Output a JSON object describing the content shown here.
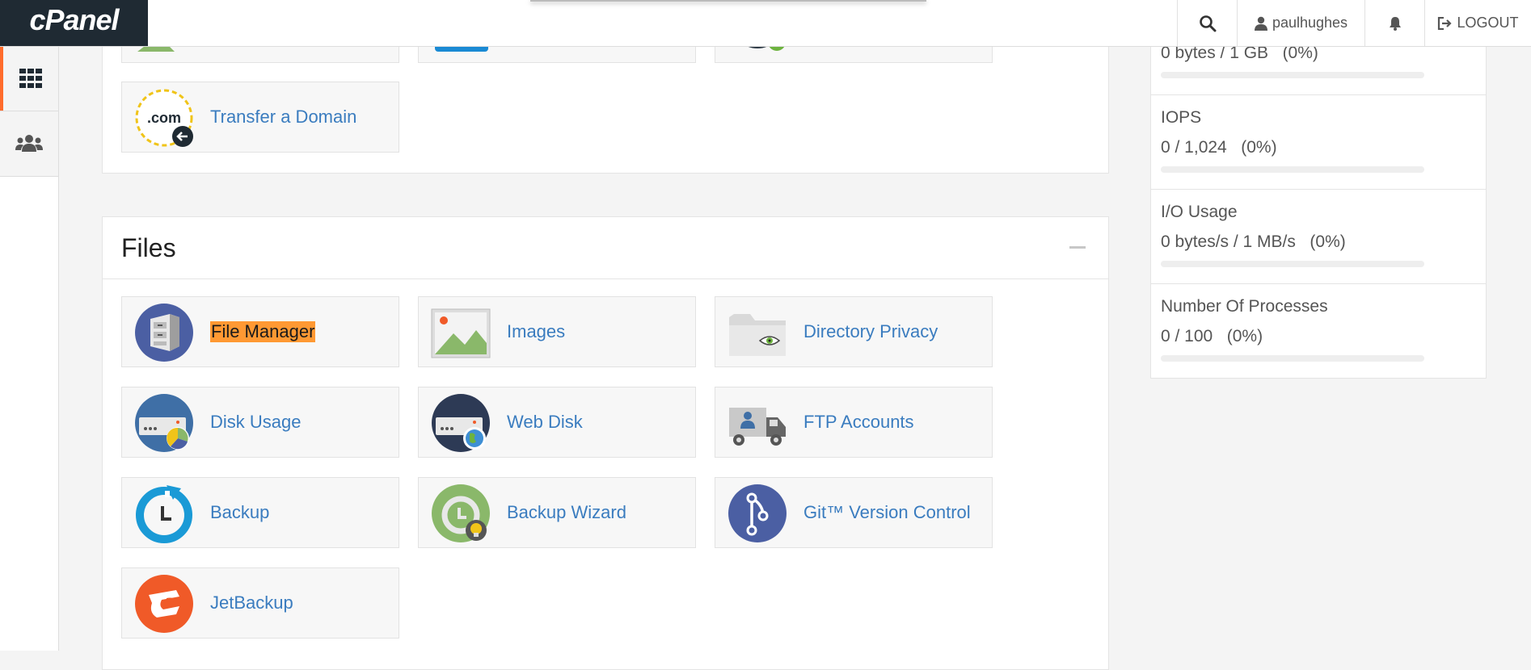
{
  "header": {
    "brand": "cPanel",
    "username": "paulhughes",
    "logout_label": "LOGOUT"
  },
  "sidebar": {
    "items": [
      {
        "icon": "grid-icon",
        "active": true
      },
      {
        "icon": "users-icon",
        "active": false
      }
    ]
  },
  "domains_section": {
    "tiles": [
      {
        "label": "Transfer a Domain",
        "icon": "transfer-domain-icon"
      }
    ]
  },
  "files_section": {
    "title": "Files",
    "tiles": [
      {
        "label": "File Manager",
        "icon": "file-manager-icon",
        "highlighted": true
      },
      {
        "label": "Images",
        "icon": "images-icon"
      },
      {
        "label": "Directory Privacy",
        "icon": "directory-privacy-icon"
      },
      {
        "label": "Disk Usage",
        "icon": "disk-usage-icon"
      },
      {
        "label": "Web Disk",
        "icon": "web-disk-icon"
      },
      {
        "label": "FTP Accounts",
        "icon": "ftp-accounts-icon"
      },
      {
        "label": "Backup",
        "icon": "backup-icon"
      },
      {
        "label": "Backup Wizard",
        "icon": "backup-wizard-icon"
      },
      {
        "label": "Git™ Version Control",
        "icon": "git-icon"
      },
      {
        "label": "JetBackup",
        "icon": "jetbackup-icon"
      }
    ]
  },
  "stats": [
    {
      "value": "0 bytes / 1 GB   (0%)",
      "percent": 0
    },
    {
      "name": "IOPS",
      "value": "0 / 1,024   (0%)",
      "percent": 0
    },
    {
      "name": "I/O Usage",
      "value": "0 bytes/s / 1 MB/s   (0%)",
      "percent": 0
    },
    {
      "name": "Number Of Processes",
      "value": "0 / 100   (0%)",
      "percent": 0
    }
  ],
  "colors": {
    "accent": "#ff6c2c",
    "link": "#3a7cbf",
    "highlight": "#ff9933",
    "brand_bg": "#1f2a33"
  }
}
